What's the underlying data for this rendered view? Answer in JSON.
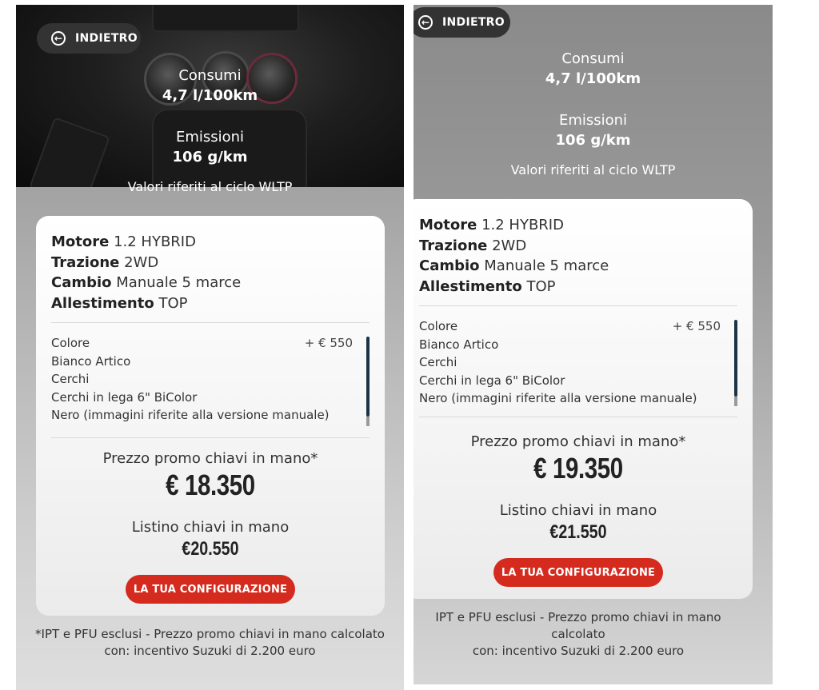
{
  "screens": [
    {
      "back_label": "INDIETRO",
      "consumi_label": "Consumi",
      "consumi_value": "4,7 l/100km",
      "emissioni_label": "Emissioni",
      "emissioni_value": "106 g/km",
      "wltp_note": "Valori riferiti al ciclo WLTP",
      "specs": [
        {
          "key": "Motore",
          "value": "1.2 HYBRID"
        },
        {
          "key": "Trazione",
          "value": "2WD"
        },
        {
          "key": "Cambio",
          "value": "Manuale 5 marce"
        },
        {
          "key": "Allestimento",
          "value": "TOP"
        }
      ],
      "options": {
        "lines": [
          "Colore",
          "Bianco Artico",
          "Cerchi",
          "Cerchi in lega 6\" BiColor",
          "Nero (immagini riferite alla versione manuale)"
        ],
        "color_price": "+ € 550"
      },
      "promo_label": "Prezzo promo chiavi in mano*",
      "promo_price": "€ 18.350",
      "list_label": "Listino chiavi in mano",
      "list_price": "€20.550",
      "cta_label": "LA TUA CONFIGURAZIONE",
      "footnote_1": "*IPT e PFU esclusi - Prezzo promo chiavi in mano calcolato",
      "footnote_2": "con: incentivo Suzuki di 2.200 euro"
    },
    {
      "back_label": "INDIETRO",
      "consumi_label": "Consumi",
      "consumi_value": "4,7 l/100km",
      "emissioni_label": "Emissioni",
      "emissioni_value": "106 g/km",
      "wltp_note": "Valori riferiti al ciclo WLTP",
      "specs": [
        {
          "key": "Motore",
          "value": "1.2 HYBRID"
        },
        {
          "key": "Trazione",
          "value": "2WD"
        },
        {
          "key": "Cambio",
          "value": "Manuale 5 marce"
        },
        {
          "key": "Allestimento",
          "value": "TOP"
        }
      ],
      "options": {
        "lines": [
          "Colore",
          "Bianco Artico",
          "Cerchi",
          "Cerchi in lega 6\" BiColor",
          "Nero (immagini riferite alla versione manuale)"
        ],
        "color_price": "+ € 550"
      },
      "promo_label": "Prezzo promo chiavi in mano*",
      "promo_price": "€ 19.350",
      "list_label": "Listino chiavi in mano",
      "list_price": "€21.550",
      "cta_label": "LA TUA CONFIGURAZIONE",
      "footnote_1": "IPT e PFU esclusi - Prezzo promo chiavi in mano calcolato",
      "footnote_2": "con: incentivo Suzuki di 2.200 euro"
    }
  ],
  "colors": {
    "cta_red": "#d52b1e",
    "back_button_bg": "#333333",
    "scrollbar": "#1b3345"
  },
  "icons": {
    "back": "circle-arrow-left-icon"
  }
}
